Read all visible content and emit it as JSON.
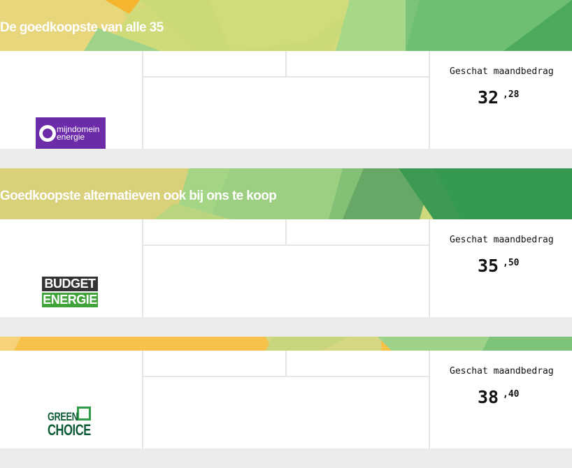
{
  "sections": [
    {
      "banner_title": "De goedkoopste van alle 35",
      "provider_logo": {
        "line1": "mijndomein",
        "line2": "energie",
        "bg": "#6c2ba8"
      },
      "price_label": "Geschat maandbedrag",
      "price_whole": "32",
      "price_cents": ",28"
    },
    {
      "banner_title": "Goedkoopste alternatieven ook bij ons te koop",
      "provider_logo": {
        "line1": "BUDGET",
        "line2": "ENERGIE",
        "bg1": "#333333",
        "bg2": "#3fa33a"
      },
      "price_label": "Geschat maandbedrag",
      "price_whole": "35",
      "price_cents": ",50"
    },
    {
      "banner_title": "",
      "provider_logo": {
        "line1": "GREEN",
        "line2": "CHOICE",
        "color": "#0d5a36"
      },
      "price_label": "Geschat maandbedrag",
      "price_whole": "38",
      "price_cents": ",40"
    }
  ],
  "colors": {
    "page_bg": "#ececec",
    "card_bg": "#ffffff",
    "divider": "#e6e6e6",
    "brand_green": "#3d9a52",
    "brand_yellow": "#f6c04a"
  }
}
